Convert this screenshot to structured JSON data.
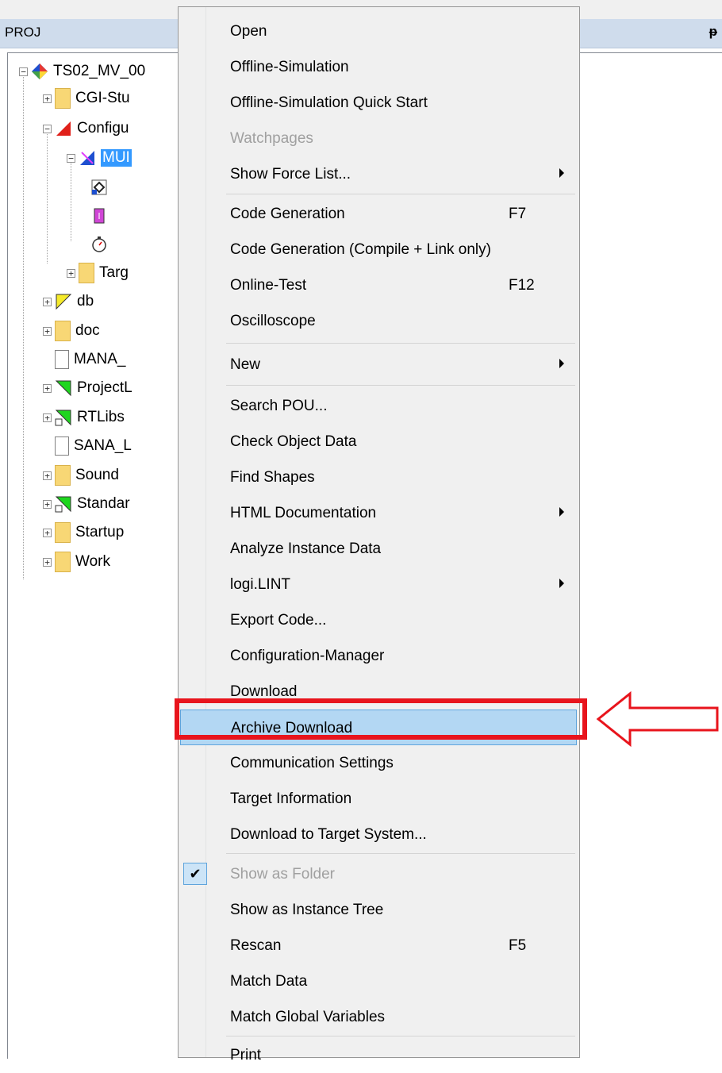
{
  "panel": {
    "title": "PROJ",
    "pin_glyph": "ᵽ"
  },
  "tree": {
    "items": [
      {
        "label": "TS02_MV_00",
        "icon": "project-diamond-icon",
        "expander": "−"
      },
      {
        "label": "CGI-Stu",
        "icon": "folder-icon",
        "expander": "+"
      },
      {
        "label": "Configu",
        "icon": "configuration-red-triangle-icon",
        "expander": "−"
      },
      {
        "label": "MUI",
        "icon": "resource-blue-icon",
        "expander": "−"
      },
      {
        "label": "",
        "icon": "gear-target-icon",
        "expander": ""
      },
      {
        "label": "",
        "icon": "task-chip-icon",
        "expander": ""
      },
      {
        "label": "",
        "icon": "stopwatch-icon",
        "expander": ""
      },
      {
        "label": "Targ",
        "icon": "folder-icon",
        "expander": "+"
      },
      {
        "label": "db",
        "icon": "yellow-triangle-icon",
        "expander": "+"
      },
      {
        "label": "doc",
        "icon": "folder-icon",
        "expander": "+"
      },
      {
        "label": "MANA_",
        "icon": "document-icon",
        "expander": ""
      },
      {
        "label": "ProjectL",
        "icon": "green-triangle-icon",
        "expander": "+"
      },
      {
        "label": "RTLibs",
        "icon": "green-triangle-link-icon",
        "expander": "+"
      },
      {
        "label": "SANA_L",
        "icon": "document-icon",
        "expander": ""
      },
      {
        "label": "Sound",
        "icon": "folder-icon",
        "expander": "+"
      },
      {
        "label": "Standar",
        "icon": "green-triangle-link-icon",
        "expander": "+"
      },
      {
        "label": "Startup",
        "icon": "folder-icon",
        "expander": "+"
      },
      {
        "label": "Work",
        "icon": "folder-icon",
        "expander": "+"
      }
    ]
  },
  "menu": {
    "items": [
      {
        "label": "Open",
        "underline": "O"
      },
      {
        "label": "Offline-Simulation"
      },
      {
        "label": "Offline-Simulation Quick Start"
      },
      {
        "label": "Watchpages",
        "disabled": true
      },
      {
        "label": "Show Force List...",
        "submenu": true
      },
      {
        "label": "Code Generation",
        "shortcut": "F7"
      },
      {
        "label": "Code Generation (Compile + Link only)"
      },
      {
        "label": "Online-Test",
        "shortcut": "F12"
      },
      {
        "label": "Oscilloscope"
      },
      {
        "label": "New",
        "submenu": true
      },
      {
        "label": "Search POU..."
      },
      {
        "label": "Check Object Data"
      },
      {
        "label": "Find Shapes"
      },
      {
        "label": "HTML Documentation",
        "submenu": true
      },
      {
        "label": "Analyze Instance Data"
      },
      {
        "label": "logi.LINT",
        "submenu": true
      },
      {
        "label": "Export Code..."
      },
      {
        "label": "Configuration-Manager"
      },
      {
        "label": "Download"
      },
      {
        "label": "Archive Download",
        "highlighted": true
      },
      {
        "label": "Communication Settings"
      },
      {
        "label": "Target Information"
      },
      {
        "label": "Download to Target System..."
      },
      {
        "label": "Show as Folder",
        "disabled": true,
        "checked": true
      },
      {
        "label": "Show as Instance Tree"
      },
      {
        "label": "Rescan",
        "shortcut": "F5"
      },
      {
        "label": "Match Data"
      },
      {
        "label": "Match Global Variables"
      },
      {
        "label": "Print"
      }
    ],
    "check_glyph": "✔"
  },
  "colors": {
    "highlight_bg": "#b3d7f3",
    "callout_red": "#e8141c",
    "panel_header": "#cfdcec",
    "selection_blue": "#3399ff"
  }
}
